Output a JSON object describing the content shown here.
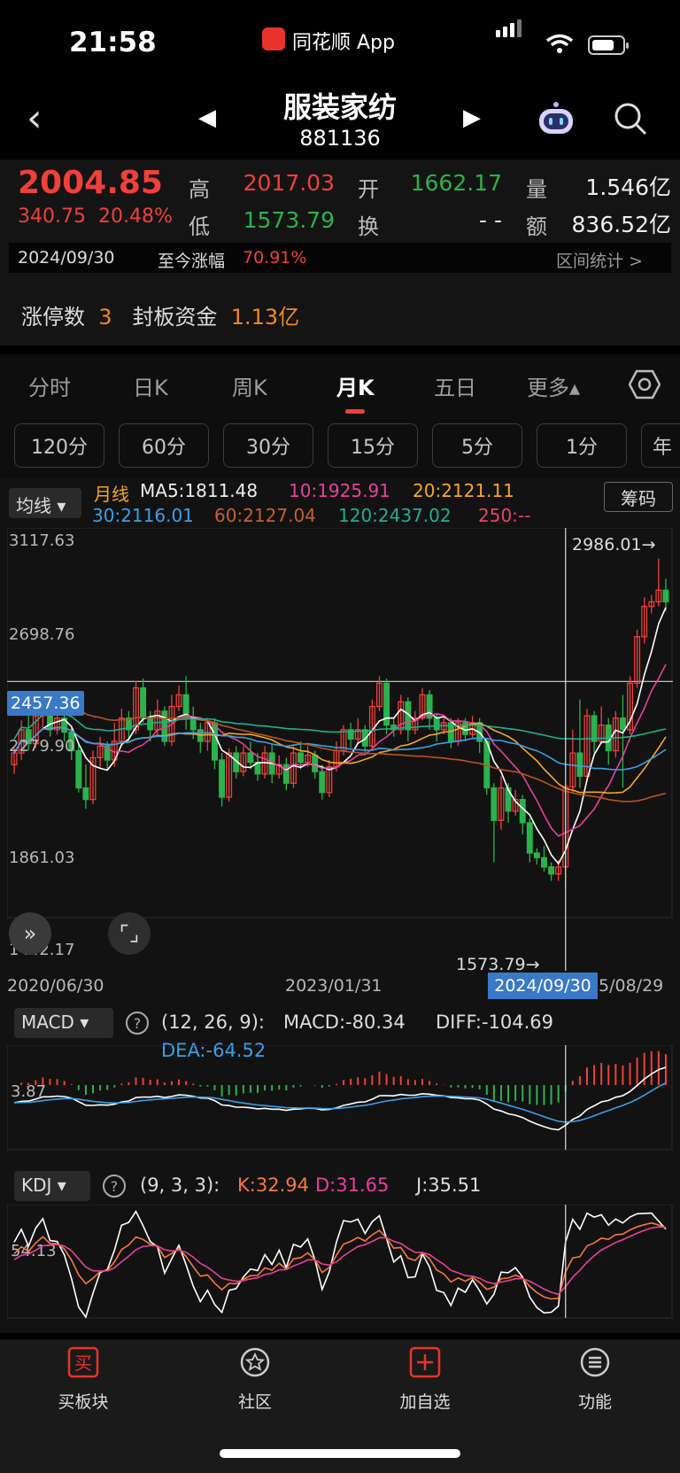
{
  "status_bar": {
    "time": "21:58",
    "app_name": "同花顺 App"
  },
  "nav": {
    "title": "服装家纺",
    "code": "881136"
  },
  "quote": {
    "price": "2004.85",
    "change": "340.75",
    "change_pct": "20.48%",
    "high_label": "高",
    "high": "2017.03",
    "open_label": "开",
    "open": "1662.17",
    "volume_label": "量",
    "volume": "1.546亿",
    "low_label": "低",
    "low": "1573.79",
    "turnover_label": "换",
    "turnover": "- -",
    "amount_label": "额",
    "amount": "836.52亿",
    "date": "2024/09/30",
    "since_label": "至今涨幅",
    "since_value": "70.91%",
    "range_stat": "区间统计 >"
  },
  "limit_row": {
    "count_label": "涨停数",
    "count": "3",
    "fund_label": "封板资金",
    "fund": "1.13亿"
  },
  "tabs": [
    "分时",
    "日K",
    "周K",
    "月K",
    "五日",
    "更多▴"
  ],
  "periods": [
    "120分",
    "60分",
    "30分",
    "15分",
    "5分",
    "1分",
    "年"
  ],
  "ma_panel": {
    "select": "均线 ▾",
    "kind": "月线",
    "ma5": "MA5:1811.48",
    "ma10": "10:1925.91",
    "ma20": "20:2121.11",
    "ma30": "30:2116.01",
    "ma60": "60:2127.04",
    "ma120": "120:2437.02",
    "ma250": "250:--",
    "chip_button": "筹码"
  },
  "chart_data": {
    "type": "candlestick",
    "y_ticks": [
      "3117.63",
      "2698.76",
      "2279.90",
      "1861.03",
      "1442.17"
    ],
    "current_price_line": "2457.36",
    "high_mark": "2986.01→",
    "low_mark": "1573.79→",
    "x_ticks": [
      "2020/06/30",
      "2023/01/31",
      "5/08/29"
    ],
    "cursor_date": "2024/09/30",
    "ylim": [
      1442.17,
      3117.63
    ],
    "candles": [
      [
        2100,
        2150,
        2060,
        2175
      ],
      [
        2150,
        2250,
        2120,
        2290
      ],
      [
        2250,
        2190,
        2160,
        2310
      ],
      [
        2190,
        2310,
        2170,
        2340
      ],
      [
        2310,
        2370,
        2260,
        2400
      ],
      [
        2370,
        2250,
        2220,
        2390
      ],
      [
        2250,
        2300,
        2230,
        2330
      ],
      [
        2300,
        2240,
        2200,
        2320
      ],
      [
        2240,
        2160,
        2120,
        2260
      ],
      [
        2160,
        2000,
        1980,
        2190
      ],
      [
        2000,
        1950,
        1910,
        2100
      ],
      [
        1950,
        2130,
        1930,
        2160
      ],
      [
        2130,
        2180,
        2080,
        2220
      ],
      [
        2180,
        2120,
        2080,
        2200
      ],
      [
        2120,
        2200,
        2090,
        2280
      ],
      [
        2200,
        2300,
        2180,
        2340
      ],
      [
        2300,
        2250,
        2200,
        2330
      ],
      [
        2250,
        2430,
        2230,
        2460
      ],
      [
        2430,
        2300,
        2280,
        2470
      ],
      [
        2300,
        2250,
        2200,
        2330
      ],
      [
        2250,
        2330,
        2220,
        2380
      ],
      [
        2330,
        2200,
        2180,
        2350
      ],
      [
        2200,
        2350,
        2180,
        2400
      ],
      [
        2350,
        2400,
        2330,
        2440
      ],
      [
        2400,
        2300,
        2250,
        2480
      ],
      [
        2300,
        2250,
        2210,
        2350
      ],
      [
        2250,
        2200,
        2150,
        2280
      ],
      [
        2200,
        2280,
        2160,
        2300
      ],
      [
        2280,
        2120,
        2080,
        2300
      ],
      [
        2120,
        1960,
        1920,
        2150
      ],
      [
        1960,
        2150,
        1940,
        2170
      ],
      [
        2150,
        2070,
        2040,
        2180
      ],
      [
        2070,
        2150,
        2050,
        2180
      ],
      [
        2150,
        2110,
        2080,
        2200
      ],
      [
        2110,
        2060,
        2030,
        2150
      ],
      [
        2060,
        2150,
        2040,
        2180
      ],
      [
        2150,
        2060,
        2020,
        2190
      ],
      [
        2060,
        2100,
        2040,
        2140
      ],
      [
        2100,
        2020,
        1990,
        2130
      ],
      [
        2020,
        2150,
        2000,
        2180
      ],
      [
        2150,
        2110,
        2080,
        2200
      ],
      [
        2110,
        2140,
        2090,
        2180
      ],
      [
        2140,
        2070,
        2040,
        2160
      ],
      [
        2070,
        1980,
        1950,
        2100
      ],
      [
        1980,
        2090,
        1960,
        2120
      ],
      [
        2090,
        2160,
        2070,
        2200
      ],
      [
        2160,
        2250,
        2140,
        2270
      ],
      [
        2250,
        2210,
        2170,
        2280
      ],
      [
        2210,
        2250,
        2190,
        2300
      ],
      [
        2250,
        2180,
        2140,
        2270
      ],
      [
        2180,
        2350,
        2170,
        2380
      ],
      [
        2350,
        2450,
        2330,
        2480
      ],
      [
        2450,
        2270,
        2230,
        2470
      ],
      [
        2270,
        2250,
        2220,
        2300
      ],
      [
        2250,
        2370,
        2230,
        2400
      ],
      [
        2370,
        2250,
        2200,
        2390
      ],
      [
        2250,
        2300,
        2230,
        2330
      ],
      [
        2300,
        2400,
        2290,
        2430
      ],
      [
        2400,
        2300,
        2250,
        2420
      ],
      [
        2300,
        2250,
        2200,
        2320
      ],
      [
        2250,
        2280,
        2230,
        2300
      ],
      [
        2280,
        2200,
        2170,
        2300
      ],
      [
        2200,
        2280,
        2180,
        2300
      ],
      [
        2280,
        2230,
        2200,
        2300
      ],
      [
        2230,
        2280,
        2210,
        2310
      ],
      [
        2280,
        2200,
        2150,
        2300
      ],
      [
        2200,
        2000,
        1970,
        2210
      ],
      [
        2000,
        1860,
        1680,
        2020
      ],
      [
        1860,
        2000,
        1820,
        2050
      ],
      [
        2000,
        1900,
        1850,
        2020
      ],
      [
        1900,
        1950,
        1880,
        1990
      ],
      [
        1950,
        1850,
        1800,
        1970
      ],
      [
        1850,
        1720,
        1680,
        1870
      ],
      [
        1720,
        1700,
        1670,
        1740
      ],
      [
        1700,
        1660,
        1640,
        1750
      ],
      [
        1660,
        1630,
        1600,
        1680
      ],
      [
        1630,
        1660,
        1600,
        1690
      ],
      [
        1660,
        2005,
        1574,
        2017
      ],
      [
        2005,
        2150,
        1980,
        2250
      ],
      [
        2150,
        2050,
        2000,
        2380
      ],
      [
        2050,
        2310,
        2030,
        2340
      ],
      [
        2310,
        2200,
        2150,
        2330
      ],
      [
        2200,
        2270,
        2190,
        2350
      ],
      [
        2270,
        2160,
        2100,
        2300
      ],
      [
        2160,
        2300,
        2130,
        2330
      ],
      [
        2300,
        2250,
        2000,
        2400
      ],
      [
        2250,
        2450,
        2230,
        2480
      ],
      [
        2450,
        2650,
        2430,
        2680
      ],
      [
        2650,
        2780,
        2620,
        2820
      ],
      [
        2780,
        2800,
        2750,
        2830
      ],
      [
        2800,
        2850,
        2780,
        2986
      ],
      [
        2850,
        2800,
        2760,
        2900
      ]
    ]
  },
  "macd_panel": {
    "select": "MACD ▾",
    "params": "(12, 26, 9):",
    "macd": "MACD:-80.34",
    "diff": "DIFF:-104.69",
    "dea": "DEA:-64.52",
    "axis_label": "3.87"
  },
  "kdj_panel": {
    "select": "KDJ ▾",
    "params": "(9, 3, 3):",
    "k": "K:32.94",
    "d": "D:31.65",
    "j": "J:35.51",
    "axis_label": "54.13"
  },
  "bottom_bar": [
    {
      "label": "买板块",
      "icon": "buy-icon",
      "glyph": "买"
    },
    {
      "label": "社区",
      "icon": "community-icon",
      "glyph": "☆"
    },
    {
      "label": "加自选",
      "icon": "add-watchlist-icon",
      "glyph": "+"
    },
    {
      "label": "功能",
      "icon": "menu-icon",
      "glyph": "≡"
    }
  ],
  "colors": {
    "up": "#f0403a",
    "down": "#2bb24c",
    "accent": "#f2881e",
    "cursor": "#3a78c8",
    "ma5": "#ffffff",
    "ma10": "#e8409a",
    "ma20": "#f5a623",
    "ma30": "#3aa0e8",
    "ma60": "#b8541e",
    "ma120": "#1fb08f"
  }
}
